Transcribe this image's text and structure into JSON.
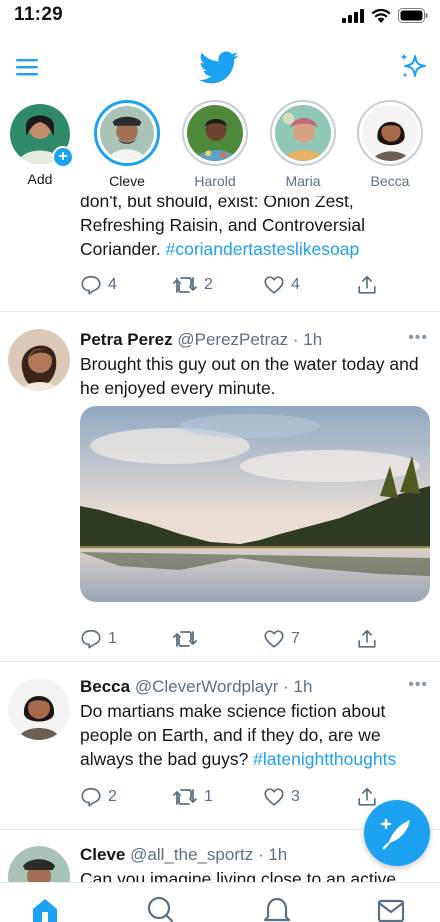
{
  "status": {
    "time": "11:29"
  },
  "topbar": {
    "menu_icon": "menu-icon",
    "logo_icon": "twitter-bird-icon",
    "sparkle_icon": "sparkle-icon"
  },
  "fleets": [
    {
      "label": "Add",
      "type": "add"
    },
    {
      "label": "Cleve",
      "type": "active"
    },
    {
      "label": "Harold",
      "type": "seen"
    },
    {
      "label": "Maria",
      "type": "seen"
    },
    {
      "label": "Becca",
      "type": "seen"
    }
  ],
  "tweets": [
    {
      "text_lines": [
        "don't, but should, exist: Onion Zest,",
        "Refreshing Raisin, and Controversial",
        "Coriander. "
      ],
      "hashtag": "#coriandertasteslikesoap",
      "replies": "4",
      "retweets": "2",
      "likes": "4"
    },
    {
      "name": "Petra Perez",
      "handle": "@PerezPetraz",
      "time": "· 1h",
      "text": "Brought this guy out on the water today and he enjoyed every minute.",
      "replies": "1",
      "retweets": "",
      "likes": "7"
    },
    {
      "name": "Becca",
      "handle": "@CleverWordplayr",
      "time": "· 1h",
      "text": "Do martians make science fiction about people on Earth, and if they do, are we always the bad guys? ",
      "hashtag": "#latenightthoughts",
      "replies": "2",
      "retweets": "1",
      "likes": "3"
    },
    {
      "name": "Cleve",
      "handle": "@all_the_sportz",
      "time": "· 1h",
      "text": "Can you imagine living close to an active"
    }
  ],
  "colors": {
    "accent": "#1da1f2",
    "text": "#14171a",
    "secondary": "#5b7083",
    "divider": "#e6ecf0"
  },
  "nav": [
    "home-icon",
    "search-icon",
    "notifications-icon",
    "messages-icon"
  ]
}
